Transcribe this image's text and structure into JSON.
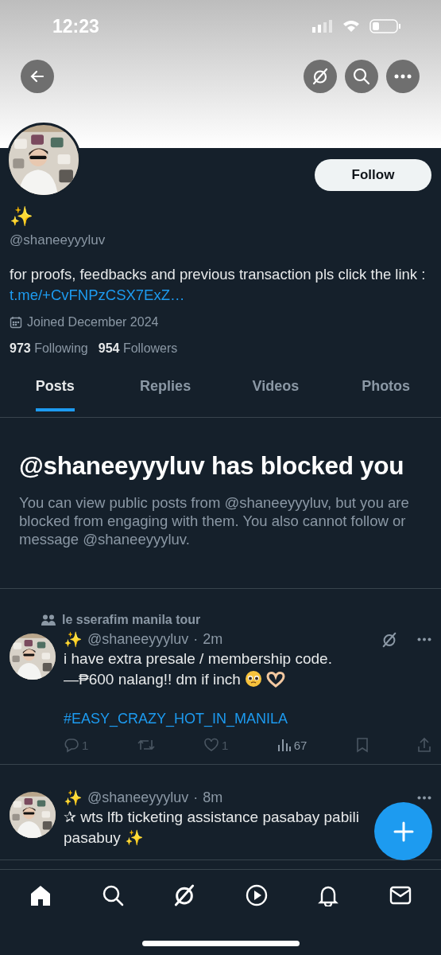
{
  "status_bar": {
    "time": "12:23"
  },
  "profile": {
    "display_name": "✨",
    "handle": "@shaneeyyyluv",
    "follow_button": "Follow",
    "bio": "for proofs, feedbacks and previous transaction pls click the link : ",
    "bio_link": "t.me/+CvFNPzCSX7ExZ…",
    "joined": "Joined December 2024",
    "stats": [
      {
        "text": "**973** Following"
      },
      {
        "text": "**954** Followers"
      }
    ]
  },
  "tabs": [
    {
      "label": "Posts",
      "selected": true
    },
    {
      "label": "Replies",
      "selected": false
    },
    {
      "label": "Videos",
      "selected": false
    },
    {
      "label": "Photos",
      "selected": false
    }
  ],
  "blocked_notice": {
    "title": "@shaneeyyyluv has blocked you",
    "message": "You can view public posts from @shaneeyyyluv, but you are blocked from engaging with them. You also cannot follow or message @shaneeyyyluv."
  },
  "posts": [
    {
      "community": "le sserafim manila tour",
      "display_name": "✨",
      "handle": "@shaneeyyyluv",
      "separator": "·",
      "time": "2m",
      "grok": true,
      "lines": [
        "i have extra presale / membership code.",
        "—₱600 nalang!! dm if inch"
      ],
      "emoji_icons": true,
      "hashtag": "#EASY_CRAZY_HOT_IN_MANILA",
      "actions": {
        "replies": "1",
        "likes": "1",
        "views": "67"
      }
    },
    {
      "display_name": "✨",
      "handle": "@shaneeyyyluv",
      "separator": "·",
      "time": "8m",
      "grok": false,
      "lines": [
        "✰ wts lfb ticketing assistance pasabay pabili pasabuy ✨"
      ],
      "emoji_icons": false
    }
  ]
}
